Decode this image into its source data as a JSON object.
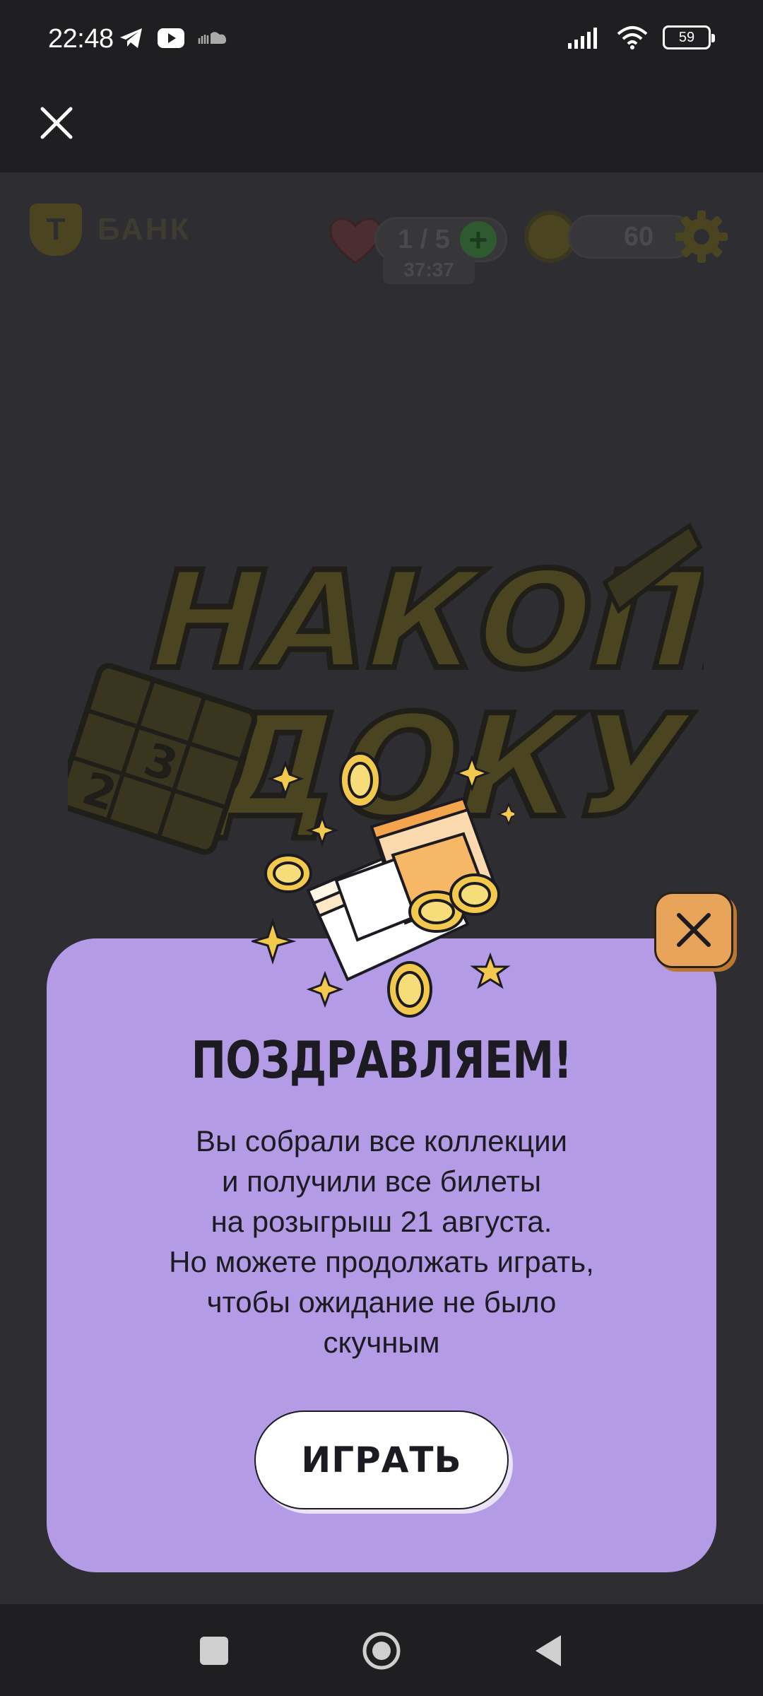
{
  "status_bar": {
    "time": "22:48",
    "battery": "59"
  },
  "brand": {
    "letter": "T",
    "name": "БАНК"
  },
  "lives": {
    "value": "1 / 5",
    "timer": "37:37"
  },
  "coins": {
    "value": "60"
  },
  "logo": {
    "line1": "НАКОПИ",
    "line2": "ДОКУ"
  },
  "popup": {
    "title": "ПОЗДРАВЛЯЕМ!",
    "message_lines": [
      "Вы собрали все коллекции",
      "и получили все билеты",
      "на розыгрыш 21 августа.",
      "Но можете продолжать играть,",
      "чтобы ожидание не было",
      "скучным"
    ],
    "play_button": "ИГРАТЬ"
  },
  "colors": {
    "popup_bg": "#b39be5",
    "close_bg": "#e9a45c",
    "accent_gold": "#f2c94c"
  }
}
